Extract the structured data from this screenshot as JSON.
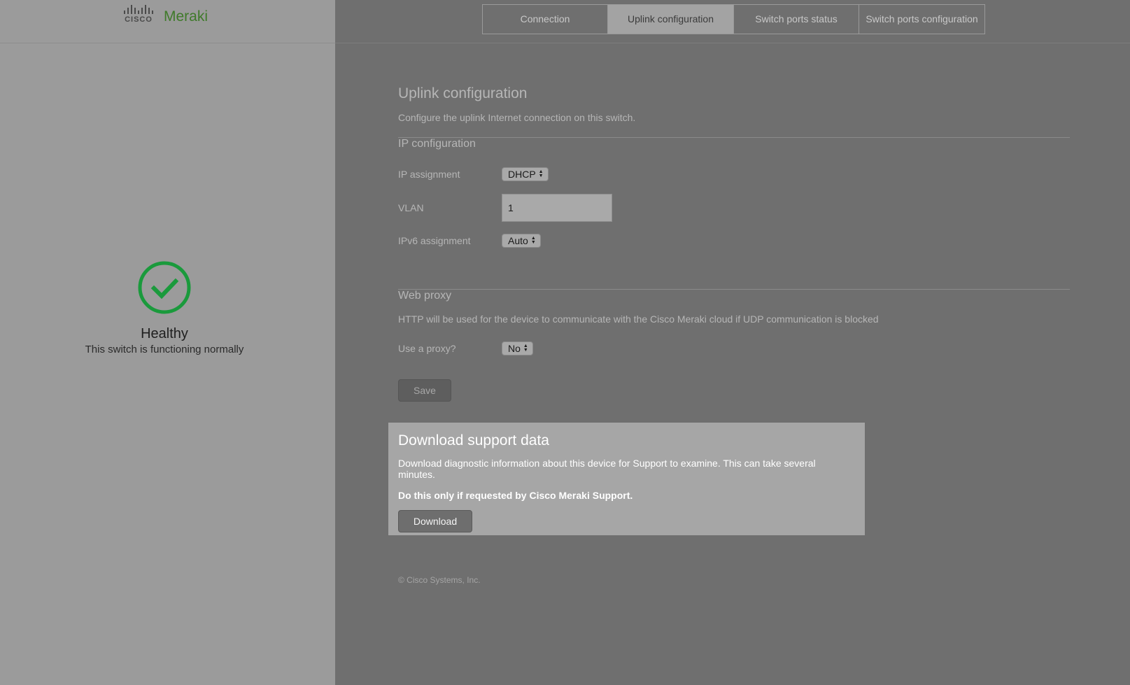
{
  "brand": {
    "cisco_text": "CISCO",
    "product": "Meraki"
  },
  "status": {
    "icon": "check-circle-icon",
    "title": "Healthy",
    "subtitle": "This switch is functioning normally",
    "color": "#1a9a3c"
  },
  "tabs": [
    {
      "label": "Connection",
      "active": false
    },
    {
      "label": "Uplink configuration",
      "active": true
    },
    {
      "label": "Switch ports status",
      "active": false
    },
    {
      "label": "Switch ports configuration",
      "active": false
    }
  ],
  "page": {
    "title": "Uplink configuration",
    "description": "Configure the uplink Internet connection on this switch."
  },
  "ip_config": {
    "title": "IP configuration",
    "ip_assignment_label": "IP assignment",
    "ip_assignment_value": "DHCP",
    "vlan_label": "VLAN",
    "vlan_value": "1",
    "ipv6_label": "IPv6 assignment",
    "ipv6_value": "Auto"
  },
  "web_proxy": {
    "title": "Web proxy",
    "description": "HTTP will be used for the device to communicate with the Cisco Meraki cloud if UDP communication is blocked",
    "use_proxy_label": "Use a proxy?",
    "use_proxy_value": "No"
  },
  "actions": {
    "save_label": "Save"
  },
  "support": {
    "title": "Download support data",
    "description": "Download diagnostic information about this device for Support to examine. This can take several minutes.",
    "warning": "Do this only if requested by Cisco Meraki Support.",
    "download_label": "Download"
  },
  "footer": {
    "copyright": "© Cisco Systems, Inc."
  }
}
